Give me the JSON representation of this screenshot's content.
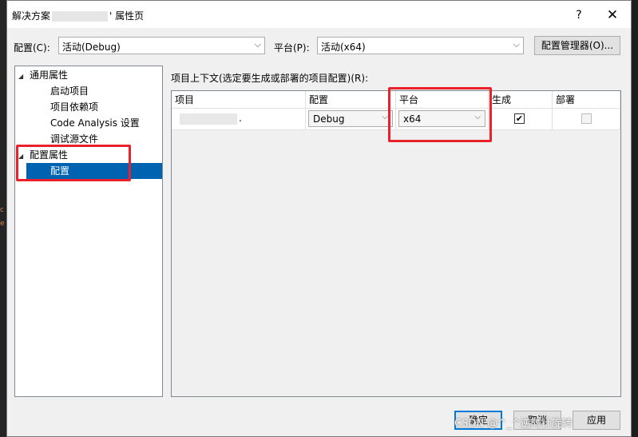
{
  "window": {
    "title_prefix": "解决方案",
    "title_suffix": "' 属性页",
    "help": "?",
    "close": "✕"
  },
  "toolbar": {
    "config_label": "配置(C):",
    "config_value": "活动(Debug)",
    "platform_label": "平台(P):",
    "platform_value": "活动(x64)",
    "manager_button": "配置管理器(O)..."
  },
  "tree": {
    "items": [
      {
        "label": "通用属性",
        "twisty": "◢"
      },
      {
        "label": "启动项目"
      },
      {
        "label": "项目依赖项"
      },
      {
        "label": "Code Analysis 设置"
      },
      {
        "label": "调试源文件"
      },
      {
        "label": "配置属性",
        "twisty": "◢"
      },
      {
        "label": "配置"
      }
    ]
  },
  "main": {
    "context_label": "项目上下文(选定要生成或部署的项目配置)(R):",
    "columns": [
      "项目",
      "配置",
      "平台",
      "生成",
      "部署"
    ],
    "row": {
      "project_suffix": ".",
      "config": "Debug",
      "platform": "x64",
      "build_checked": "✔"
    }
  },
  "footer": {
    "ok": "确定",
    "cancel": "取消",
    "apply": "应用"
  },
  "watermark": "CSDN @^_^逆时针旋转",
  "colors": {
    "highlight": "#e8212a",
    "selection": "#0063b1"
  },
  "icons": {
    "dropdown": "chevron-down-icon",
    "expand": "tree-expand-icon",
    "check": "check-icon"
  }
}
